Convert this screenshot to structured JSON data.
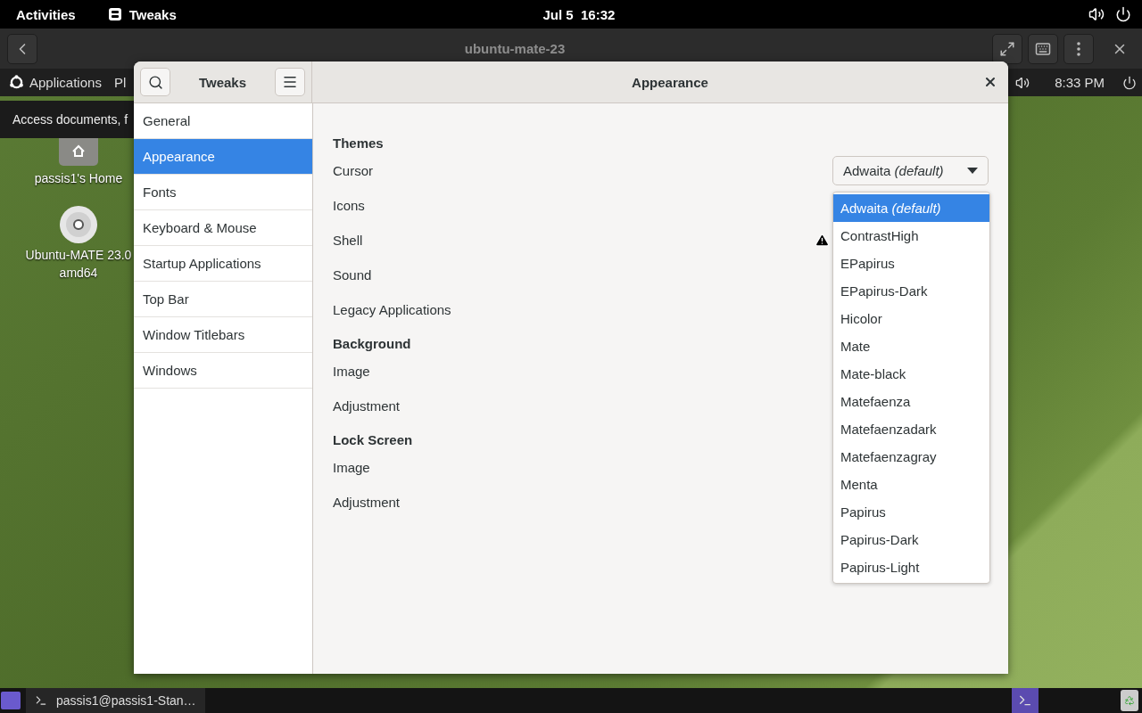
{
  "top_bar": {
    "activities": "Activities",
    "app": "Tweaks",
    "clock": "Jul 5  16:32"
  },
  "viewer": {
    "title": "ubuntu-mate-23"
  },
  "remote_desktop": {
    "panel": {
      "menus": [
        "Applications",
        "Pl"
      ],
      "clock": "8:33 PM"
    },
    "tooltip": "Access documents, f",
    "icons": [
      {
        "kind": "folder",
        "lines": [
          "passis1's Home"
        ]
      },
      {
        "kind": "disc",
        "lines": [
          "Ubuntu-MATE 23.0",
          "amd64"
        ]
      }
    ],
    "taskbar": {
      "tasks": [
        {
          "label": "passis1@passis1-Stan…"
        }
      ]
    }
  },
  "tweaks": {
    "title": "Tweaks",
    "page_title": "Appearance",
    "sidebar": [
      {
        "label": "General",
        "selected": false
      },
      {
        "label": "Appearance",
        "selected": true
      },
      {
        "label": "Fonts",
        "selected": false
      },
      {
        "label": "Keyboard & Mouse",
        "selected": false
      },
      {
        "label": "Startup Applications",
        "selected": false
      },
      {
        "label": "Top Bar",
        "selected": false
      },
      {
        "label": "Window Titlebars",
        "selected": false
      },
      {
        "label": "Windows",
        "selected": false
      }
    ],
    "sections": [
      {
        "title": "Themes",
        "rows": [
          {
            "label": "Cursor",
            "kind": "dropdown",
            "value": "Adwaita *(default)*"
          },
          {
            "label": "Icons",
            "kind": "plain"
          },
          {
            "label": "Shell",
            "kind": "warning"
          },
          {
            "label": "Sound",
            "kind": "plain"
          },
          {
            "label": "Legacy Applications",
            "kind": "plain"
          }
        ]
      },
      {
        "title": "Background",
        "rows": [
          {
            "label": "Image",
            "kind": "plain"
          },
          {
            "label": "Adjustment",
            "kind": "plain"
          }
        ]
      },
      {
        "title": "Lock Screen",
        "rows": [
          {
            "label": "Image",
            "kind": "plain"
          },
          {
            "label": "Adjustment",
            "kind": "plain"
          }
        ]
      }
    ],
    "dropdown_list": [
      {
        "label": "Adwaita *(default)*",
        "selected": true
      },
      {
        "label": "ContrastHigh",
        "selected": false
      },
      {
        "label": "EPapirus",
        "selected": false
      },
      {
        "label": "EPapirus-Dark",
        "selected": false
      },
      {
        "label": "Hicolor",
        "selected": false
      },
      {
        "label": "Mate",
        "selected": false
      },
      {
        "label": "Mate-black",
        "selected": false
      },
      {
        "label": "Matefaenza",
        "selected": false
      },
      {
        "label": "Matefaenzadark",
        "selected": false
      },
      {
        "label": "Matefaenzagray",
        "selected": false
      },
      {
        "label": "Menta",
        "selected": false
      },
      {
        "label": "Papirus",
        "selected": false
      },
      {
        "label": "Papirus-Dark",
        "selected": false
      },
      {
        "label": "Papirus-Light",
        "selected": false
      }
    ]
  }
}
